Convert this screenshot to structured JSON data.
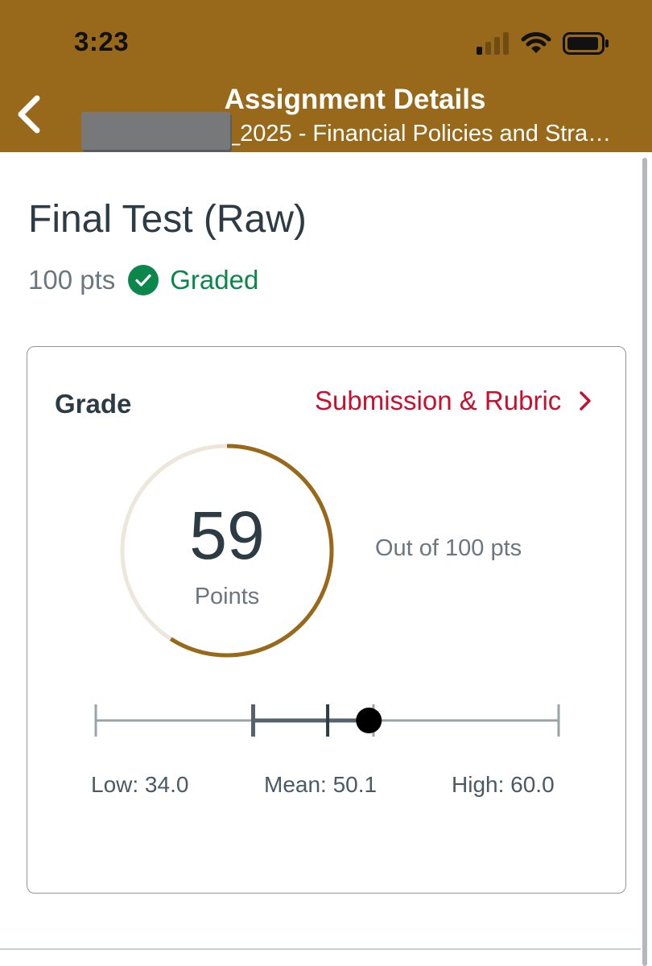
{
  "status_bar": {
    "time": "3:23",
    "icons": [
      "cellular-signal-icon",
      "wifi-icon",
      "battery-icon"
    ]
  },
  "nav": {
    "title": "Assignment Details",
    "subtitle": "_2025 - Financial Policies and Stra…",
    "back_icon": "chevron-left-icon",
    "background": "#98691a"
  },
  "assignment": {
    "title": "Final Test (Raw)",
    "points_possible": "100 pts",
    "status": "Graded",
    "status_color": "#0b874b"
  },
  "grade_card": {
    "label": "Grade",
    "rubric_link": "Submission & Rubric",
    "score": "59",
    "score_fraction": 0.59,
    "score_unit": "Points",
    "out_of": "Out of 100 pts",
    "accent": "#98691a",
    "ring_track": "#ede6db",
    "link_color": "#c8102e"
  },
  "statistics": {
    "low": "Low: 34.0",
    "mean": "Mean: 50.1",
    "high": "High: 60.0",
    "low_value": 34.0,
    "mean_value": 50.1,
    "high_value": 60.0,
    "score_value": 59
  }
}
